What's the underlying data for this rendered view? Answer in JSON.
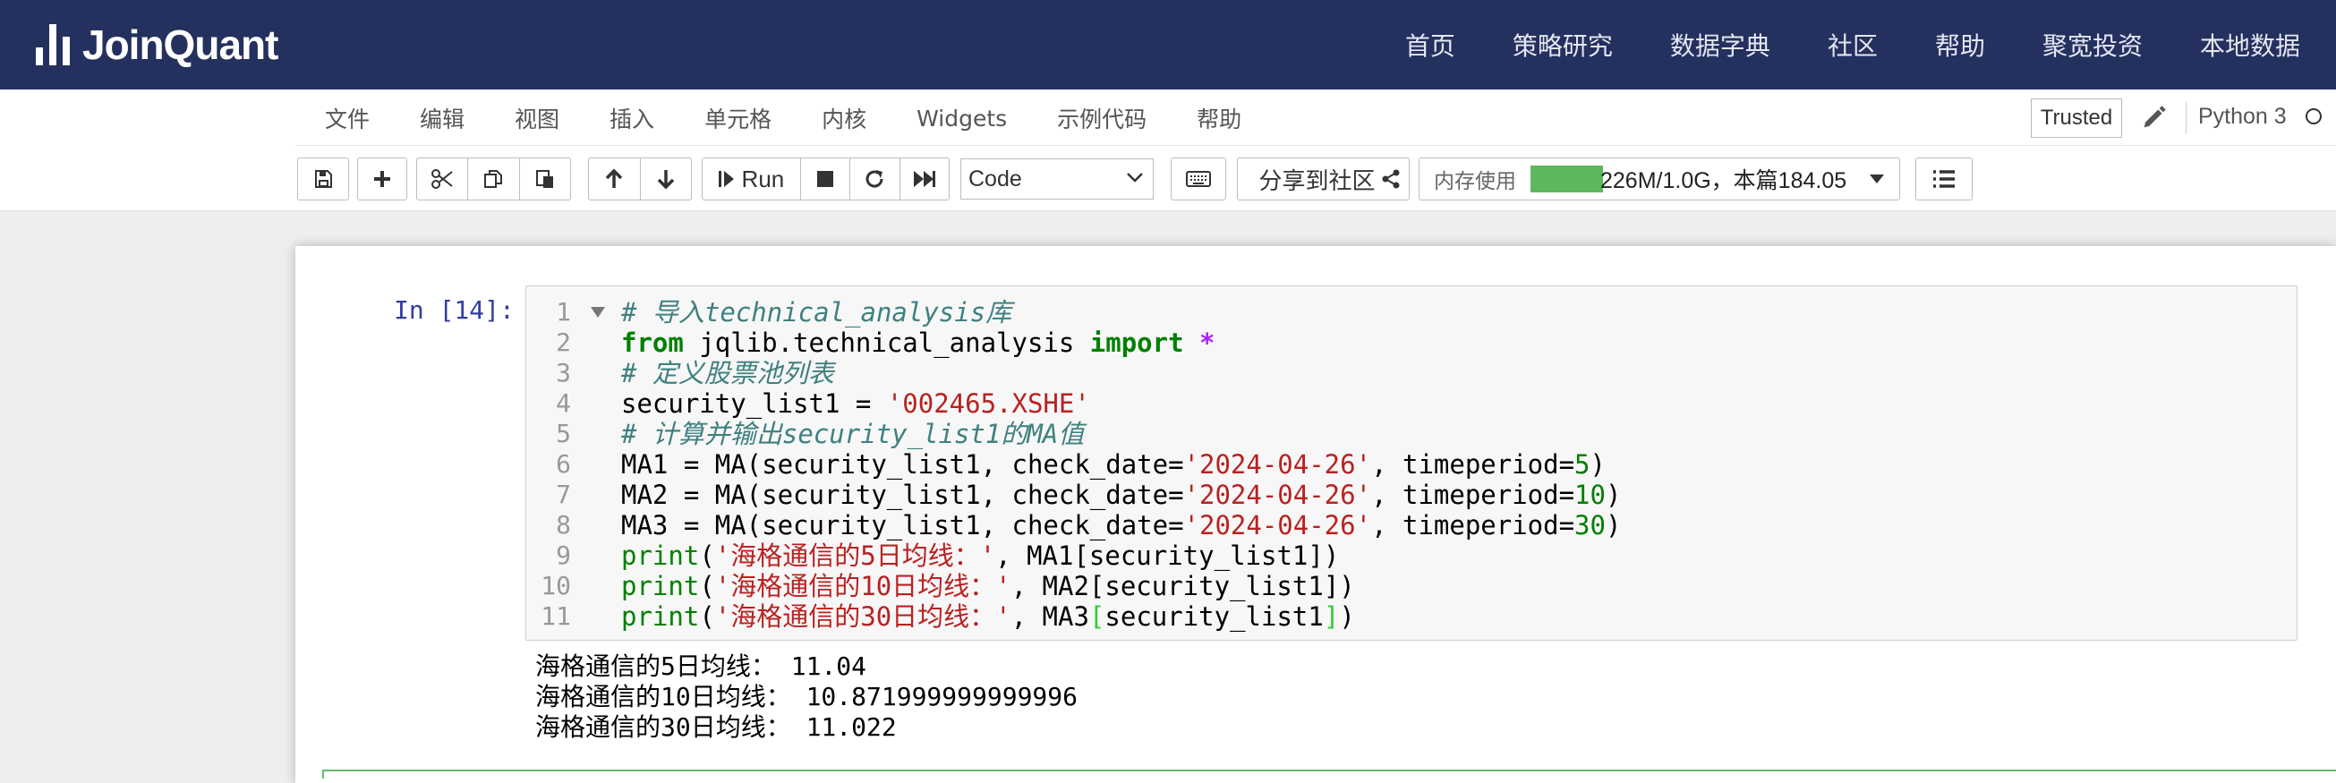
{
  "brand": {
    "name": "JoinQuant"
  },
  "top_nav": [
    "首页",
    "策略研究",
    "数据字典",
    "社区",
    "帮助",
    "聚宽投资",
    "本地数据"
  ],
  "menu": [
    "文件",
    "编辑",
    "视图",
    "插入",
    "单元格",
    "内核",
    "Widgets",
    "示例代码",
    "帮助"
  ],
  "status": {
    "trusted": "Trusted",
    "kernel": "Python 3"
  },
  "toolbar": {
    "run_label": "Run",
    "cell_type": "Code",
    "share_label": "分享到社区",
    "memory_label": "内存使用",
    "memory_text": "226M/1.0G，本篇184.05",
    "memory_fraction": 0.22
  },
  "icons": [
    "save-icon",
    "plus-icon",
    "cut-icon",
    "copy-icon",
    "paste-icon",
    "arrow-up-icon",
    "arrow-down-icon",
    "play-icon",
    "stop-icon",
    "restart-icon",
    "fast-forward-icon",
    "chevron-down-icon",
    "keyboard-icon",
    "share-icon",
    "caret-down-icon",
    "list-icon",
    "pencil-icon"
  ],
  "cell": {
    "prompt": "In [14]:",
    "line_numbers": [
      "1",
      "2",
      "3",
      "4",
      "5",
      "6",
      "7",
      "8",
      "9",
      "10",
      "11"
    ],
    "code_lines": [
      [
        {
          "t": "cm",
          "s": "# 导入technical_analysis库"
        }
      ],
      [
        {
          "t": "kw",
          "s": "from"
        },
        {
          "t": "",
          "s": " jqlib.technical_analysis "
        },
        {
          "t": "kw",
          "s": "import"
        },
        {
          "t": "",
          "s": " "
        },
        {
          "t": "op",
          "s": "*"
        }
      ],
      [
        {
          "t": "cm",
          "s": "# 定义股票池列表"
        }
      ],
      [
        {
          "t": "",
          "s": "security_list1 = "
        },
        {
          "t": "st",
          "s": "'002465.XSHE'"
        }
      ],
      [
        {
          "t": "cm",
          "s": "# 计算并输出security_list1的MA值"
        }
      ],
      [
        {
          "t": "",
          "s": "MA1 = MA(security_list1, check_date="
        },
        {
          "t": "st",
          "s": "'2024-04-26'"
        },
        {
          "t": "",
          "s": ", timeperiod="
        },
        {
          "t": "nm",
          "s": "5"
        },
        {
          "t": "",
          "s": ")"
        }
      ],
      [
        {
          "t": "",
          "s": "MA2 = MA(security_list1, check_date="
        },
        {
          "t": "st",
          "s": "'2024-04-26'"
        },
        {
          "t": "",
          "s": ", timeperiod="
        },
        {
          "t": "nm",
          "s": "10"
        },
        {
          "t": "",
          "s": ")"
        }
      ],
      [
        {
          "t": "",
          "s": "MA3 = MA(security_list1, check_date="
        },
        {
          "t": "st",
          "s": "'2024-04-26'"
        },
        {
          "t": "",
          "s": ", timeperiod="
        },
        {
          "t": "nm",
          "s": "30"
        },
        {
          "t": "",
          "s": ")"
        }
      ],
      [
        {
          "t": "bi",
          "s": "print"
        },
        {
          "t": "",
          "s": "("
        },
        {
          "t": "st",
          "s": "'海格通信的5日均线：'"
        },
        {
          "t": "",
          "s": ", MA1[security_list1])"
        }
      ],
      [
        {
          "t": "bi",
          "s": "print"
        },
        {
          "t": "",
          "s": "("
        },
        {
          "t": "st",
          "s": "'海格通信的10日均线：'"
        },
        {
          "t": "",
          "s": ", MA2[security_list1])"
        }
      ],
      [
        {
          "t": "bi",
          "s": "print"
        },
        {
          "t": "",
          "s": "("
        },
        {
          "t": "st",
          "s": "'海格通信的30日均线：'"
        },
        {
          "t": "",
          "s": ", MA3"
        },
        {
          "t": "br",
          "s": "["
        },
        {
          "t": "",
          "s": "security_list1"
        },
        {
          "t": "br",
          "s": "]"
        },
        {
          "t": "",
          "s": ")"
        }
      ]
    ],
    "output_lines": [
      "海格通信的5日均线： 11.04",
      "海格通信的10日均线： 10.871999999999996",
      "海格通信的30日均线： 11.022"
    ]
  },
  "colors": {
    "nav_bg": "#24305e",
    "memory_bar": "#5cb85c",
    "prompt": "#303f9f",
    "selected_cell": "#66bb6a"
  }
}
